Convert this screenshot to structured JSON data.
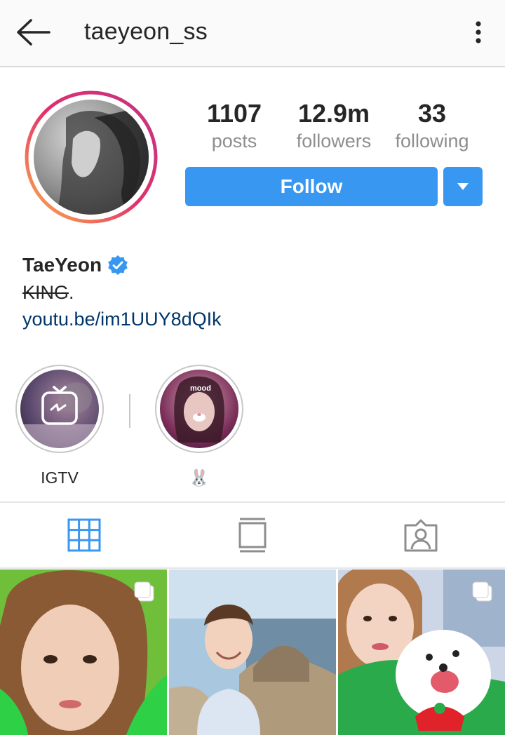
{
  "header": {
    "username": "taeyeon_ss",
    "back_icon": "arrow-left-icon",
    "more_icon": "vertical-ellipsis-icon"
  },
  "profile": {
    "avatar_icon": "profile-photo",
    "stats": [
      {
        "value": "1107",
        "label": "posts"
      },
      {
        "value": "12.9m",
        "label": "followers"
      },
      {
        "value": "33",
        "label": "following"
      }
    ],
    "follow_label": "Follow",
    "dropdown_icon": "caret-down-icon",
    "name": "TaeYeon",
    "verified_icon": "verified-badge-icon",
    "bio_strike": "KING",
    "bio_tail": ".",
    "link": "youtu.be/im1UUY8dQIk"
  },
  "highlights": [
    {
      "label": "IGTV",
      "icon": "igtv-icon"
    },
    {
      "label": "🐰",
      "overlay_text": "mood"
    }
  ],
  "tabs": [
    {
      "name": "grid",
      "icon": "grid-icon",
      "active": true
    },
    {
      "name": "feed",
      "icon": "feed-icon",
      "active": false
    },
    {
      "name": "tagged",
      "icon": "tagged-person-icon",
      "active": false
    }
  ],
  "posts": [
    {
      "multiple": true
    },
    {
      "multiple": false
    },
    {
      "multiple": true
    }
  ],
  "colors": {
    "accent": "#3897f0",
    "link": "#003569",
    "muted": "#8e8e8e",
    "ring_start": "#c13584",
    "ring_end": "#fdb44a"
  }
}
